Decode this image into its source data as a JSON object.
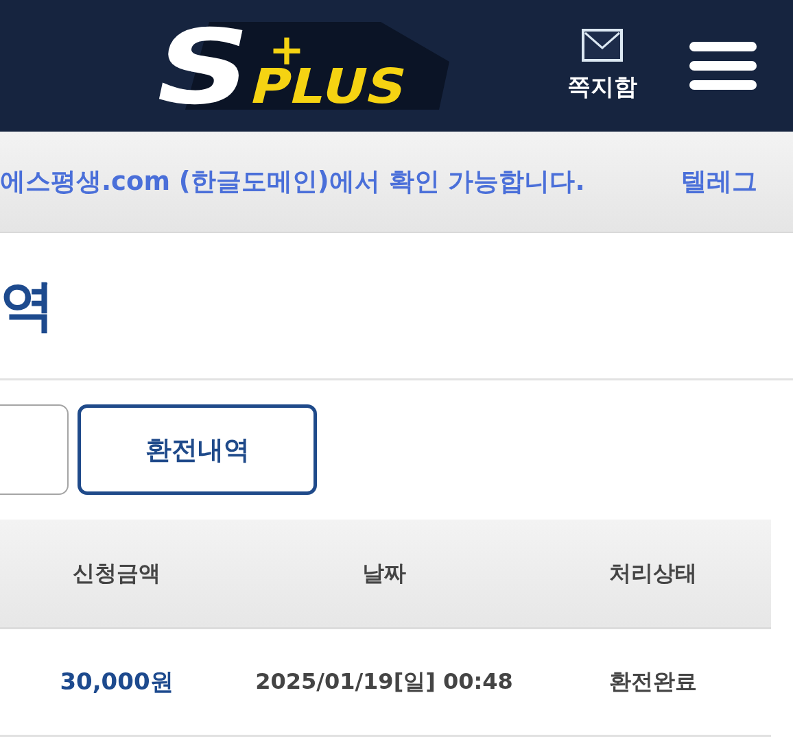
{
  "header": {
    "logo": {
      "letter": "S",
      "mark": "+",
      "word": "PLUS"
    },
    "messages": {
      "label": "쪽지함"
    }
  },
  "notice_bar": {
    "items": [
      "에스평생.com (한글도메인)에서 확인 가능합니다.",
      "텔레그"
    ]
  },
  "page_title": "역",
  "tabs": [
    {
      "selected": false
    },
    {
      "label": "환전내역",
      "selected": true
    }
  ],
  "table": {
    "columns": [
      "신청금액",
      "날짜",
      "처리상태"
    ],
    "rows": [
      [
        "30,000원",
        "2025/01/19[일] 00:48",
        "환전완료"
      ]
    ]
  }
}
